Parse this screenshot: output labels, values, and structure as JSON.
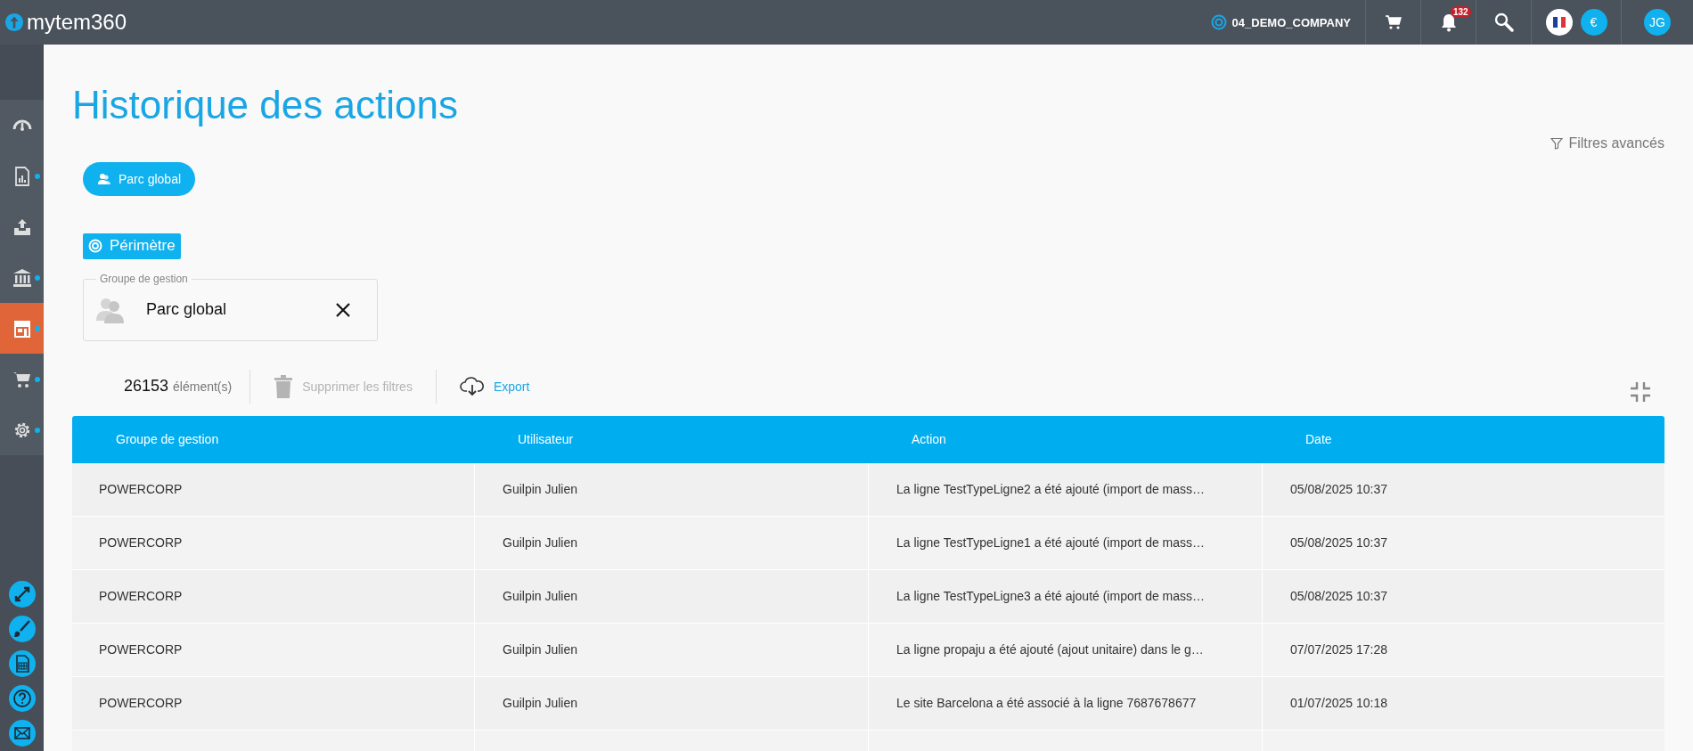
{
  "topbar": {
    "logo": "my**tem**360",
    "company": "04_DEMO_COMPANY",
    "notification_count": "132",
    "currency": "€",
    "user_initials": "JG"
  },
  "sidebar": {
    "items": [
      {
        "kind": "gauge",
        "selected": false,
        "dot": false
      },
      {
        "kind": "report",
        "selected": false,
        "dot": true
      },
      {
        "kind": "upload",
        "selected": false,
        "dot": false
      },
      {
        "kind": "bank",
        "selected": false,
        "dot": true
      },
      {
        "kind": "store",
        "selected": true,
        "dot": true
      },
      {
        "kind": "cart",
        "selected": false,
        "dot": true
      },
      {
        "kind": "gear",
        "selected": false,
        "dot": true
      }
    ],
    "tools": [
      {
        "kind": "expand"
      },
      {
        "kind": "brush"
      },
      {
        "kind": "sheet"
      },
      {
        "kind": "help"
      },
      {
        "kind": "mail"
      }
    ]
  },
  "page_title": "Historique des actions",
  "advanced_filters": "Filtres avancés",
  "scope_chip": "Parc global",
  "section_label": "Périmètre",
  "management_group_field": {
    "label": "Groupe de gestion",
    "value": "Parc global"
  },
  "toolbar": {
    "count": "26153",
    "count_unit": "élément(s)",
    "clear_filters": "Supprimer les filtres",
    "clear_filters_disabled": true,
    "export": "Export"
  },
  "table": {
    "columns": [
      "Groupe de gestion",
      "Utilisateur",
      "Action",
      "Date"
    ],
    "rows": [
      [
        "POWERCORP",
        "Guilpin Julien",
        "La ligne TestTypeLigne2 a été ajouté (import de mass…",
        "05/08/2025 10:37"
      ],
      [
        "POWERCORP",
        "Guilpin Julien",
        "La ligne TestTypeLigne1 a été ajouté (import de mass…",
        "05/08/2025 10:37"
      ],
      [
        "POWERCORP",
        "Guilpin Julien",
        "La ligne TestTypeLigne3 a été ajouté (import de mass…",
        "05/08/2025 10:37"
      ],
      [
        "POWERCORP",
        "Guilpin Julien",
        "La ligne propaju a été ajouté (ajout unitaire) dans le g…",
        "07/07/2025 17:28"
      ],
      [
        "POWERCORP",
        "Guilpin Julien",
        "Le site Barcelona a été associé à la ligne 7687678677",
        "01/07/2025 10:18"
      ]
    ]
  }
}
